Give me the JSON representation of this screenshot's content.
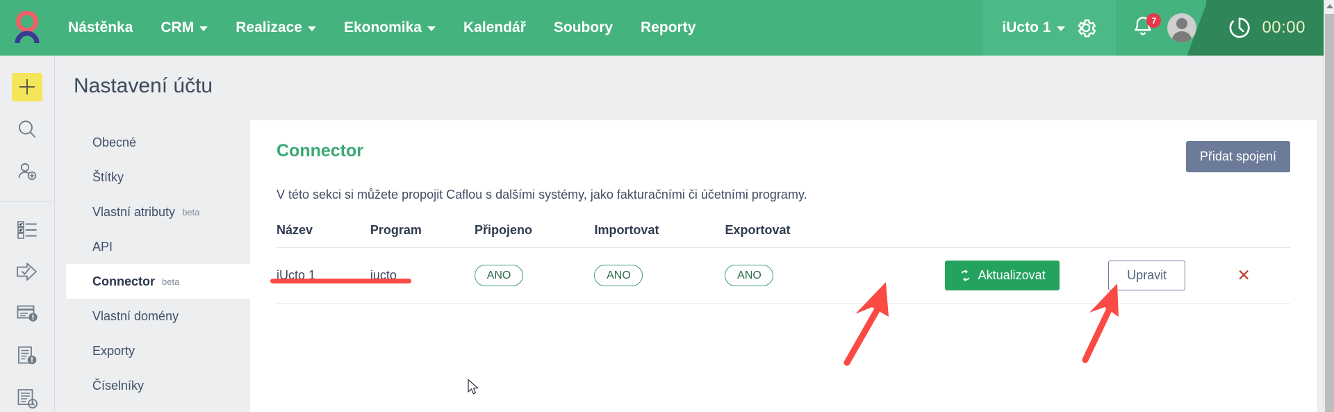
{
  "brand": {
    "logo_name": "caflou-logo",
    "logo_head_color": "#ea6168",
    "logo_body_color": "#3b3a93",
    "header_bg": "#45b37e",
    "accent_green": "#3aa876",
    "update_green": "#24a35f",
    "slate_blue": "#6c7b99",
    "annotation_red": "#fb4a44"
  },
  "topnav": {
    "items": [
      {
        "label": "Nástěnka",
        "has_caret": false
      },
      {
        "label": "CRM",
        "has_caret": true
      },
      {
        "label": "Realizace",
        "has_caret": true
      },
      {
        "label": "Ekonomika",
        "has_caret": true
      },
      {
        "label": "Kalendář",
        "has_caret": false
      },
      {
        "label": "Soubory",
        "has_caret": false
      },
      {
        "label": "Reporty",
        "has_caret": false
      }
    ],
    "account_label": "iUcto 1",
    "gear_icon": "gear-icon",
    "bell_icon": "bell-icon",
    "notification_count": "7",
    "avatar_icon": "user-avatar",
    "timer_icon": "timer-icon",
    "timer_value": "00:00"
  },
  "iconbar": {
    "items": [
      {
        "name": "plus-icon",
        "label": "Přidat"
      },
      {
        "name": "search-icon",
        "label": "Hledat"
      },
      {
        "name": "add-user-icon",
        "label": "Přidat uživatele"
      },
      {
        "name": "checklist-icon",
        "label": "Úkoly"
      },
      {
        "name": "arrow-check-icon",
        "label": "Workflow"
      },
      {
        "name": "card-alert-icon",
        "label": "Platby"
      },
      {
        "name": "document-alert-icon",
        "label": "Dokumenty"
      },
      {
        "name": "list-clock-icon",
        "label": "Výkazy"
      }
    ]
  },
  "page": {
    "title": "Nastavení účtu"
  },
  "settings_nav": {
    "items": [
      {
        "label": "Obecné",
        "beta": "",
        "active": false
      },
      {
        "label": "Štítky",
        "beta": "",
        "active": false
      },
      {
        "label": "Vlastní atributy",
        "beta": "beta",
        "active": false
      },
      {
        "label": "API",
        "beta": "",
        "active": false
      },
      {
        "label": "Connector",
        "beta": "beta",
        "active": true
      },
      {
        "label": "Vlastní domény",
        "beta": "",
        "active": false
      },
      {
        "label": "Exporty",
        "beta": "",
        "active": false
      },
      {
        "label": "Číselníky",
        "beta": "",
        "active": false
      }
    ]
  },
  "connector": {
    "title": "Connector",
    "add_button": "Přidat spojení",
    "description": "V této sekci si můžete propojit Caflou s dalšími systémy, jako fakturačními či účetními programy.",
    "columns": [
      "Název",
      "Program",
      "Připojeno",
      "Importovat",
      "Exportovat"
    ],
    "rows": [
      {
        "name": "iUcto 1",
        "program": "iucto",
        "connected": "ANO",
        "import": "ANO",
        "export": "ANO",
        "update_label": "Aktualizovat",
        "update_icon": "refresh-icon",
        "edit_label": "Upravit",
        "delete_icon": "close-icon",
        "delete_label": "✕"
      }
    ]
  },
  "annotations": {
    "underline_target": "iUcto 1",
    "arrow1_target": "Aktualizovat",
    "arrow2_target": "Upravit",
    "cursor": "mouse-pointer"
  }
}
